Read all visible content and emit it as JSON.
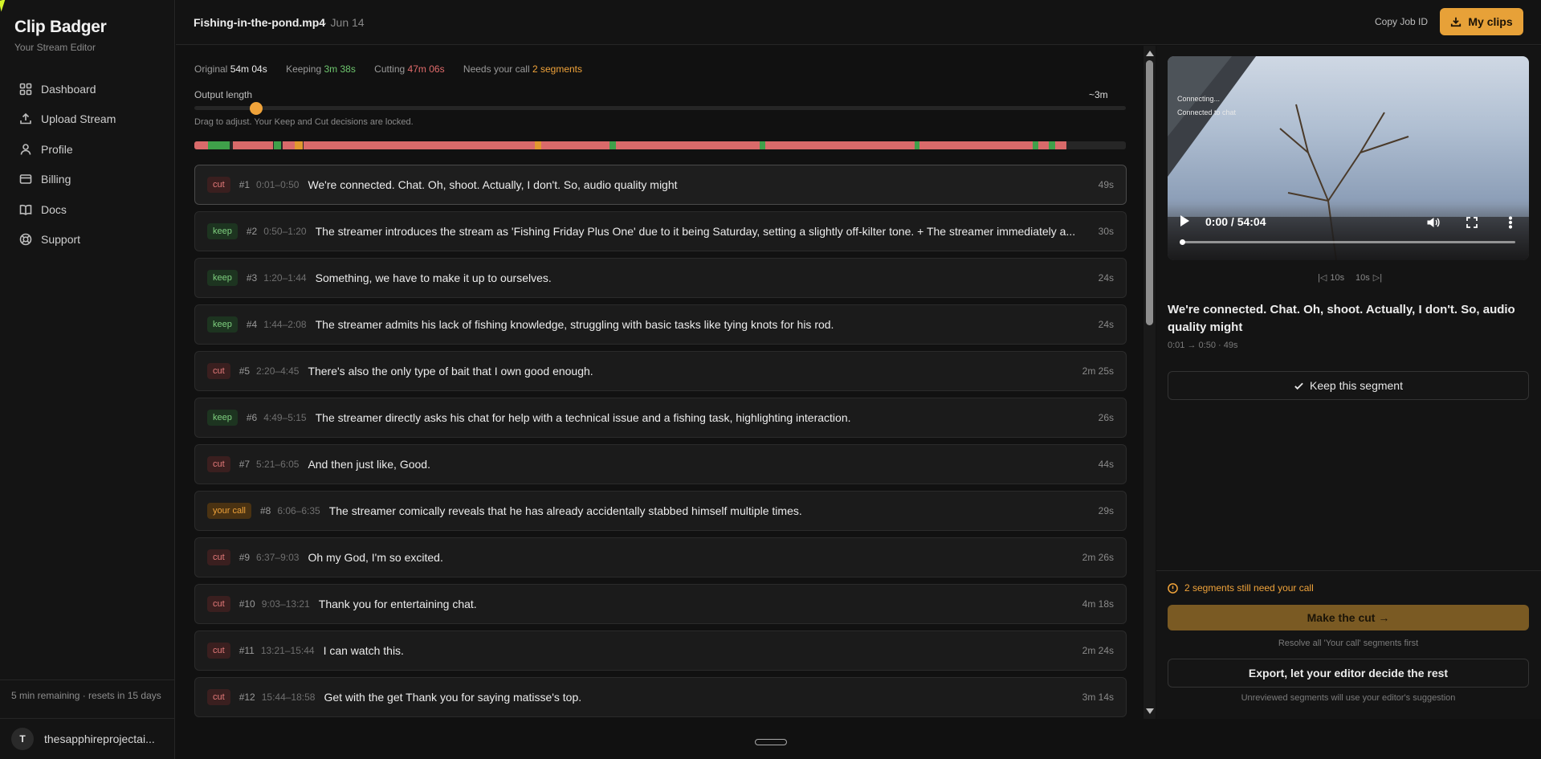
{
  "brand": {
    "title": "Clip Badger",
    "subtitle": "Your Stream Editor"
  },
  "sidebar": {
    "items": [
      {
        "label": "Dashboard",
        "icon": "grid-icon"
      },
      {
        "label": "Upload Stream",
        "icon": "upload-icon"
      },
      {
        "label": "Profile",
        "icon": "user-icon"
      },
      {
        "label": "Billing",
        "icon": "card-icon"
      },
      {
        "label": "Docs",
        "icon": "book-icon"
      },
      {
        "label": "Support",
        "icon": "lifebuoy-icon"
      }
    ],
    "quota": "5 min remaining · resets in 15 days",
    "user": {
      "initial": "T",
      "name": "thesapphireprojectai..."
    }
  },
  "header": {
    "file_name": "Fishing-in-the-pond.mp4",
    "file_date": "· Jun 14",
    "copy_job_id": "Copy Job ID",
    "my_clips": "My clips"
  },
  "stats": {
    "original_label": "Original",
    "original_value": "54m 04s",
    "keeping_label": "Keeping",
    "keeping_value": "3m 38s",
    "cutting_label": "Cutting",
    "cutting_value": "47m 06s",
    "call_label": "Needs your call",
    "call_value": "2 segments"
  },
  "output": {
    "label": "Output length",
    "value": "~3m",
    "slider_fraction": 0.066,
    "hint": "Drag to adjust. Your Keep and Cut decisions are locked."
  },
  "colors": {
    "cut": "#d96a6a",
    "keep": "#3fa04a",
    "call": "#e0982f",
    "accent": "#e7a138"
  },
  "timeline": {
    "total_seconds": 3244,
    "segments": [
      {
        "type": "cut",
        "start": 1,
        "end": 50
      },
      {
        "type": "keep",
        "start": 50,
        "end": 80
      },
      {
        "type": "keep",
        "start": 80,
        "end": 104
      },
      {
        "type": "keep",
        "start": 104,
        "end": 128
      },
      {
        "type": "cut",
        "start": 140,
        "end": 285
      },
      {
        "type": "keep",
        "start": 289,
        "end": 315
      },
      {
        "type": "cut",
        "start": 321,
        "end": 365
      },
      {
        "type": "call",
        "start": 366,
        "end": 395
      },
      {
        "type": "cut",
        "start": 397,
        "end": 543
      },
      {
        "type": "cut",
        "start": 543,
        "end": 801
      },
      {
        "type": "cut",
        "start": 801,
        "end": 944
      },
      {
        "type": "cut",
        "start": 944,
        "end": 1138
      },
      {
        "type": "cut",
        "start": 1138,
        "end": 1240
      },
      {
        "type": "call",
        "start": 1240,
        "end": 1262
      },
      {
        "type": "cut",
        "start": 1262,
        "end": 1512
      },
      {
        "type": "keep",
        "start": 1512,
        "end": 1535
      },
      {
        "type": "cut",
        "start": 1535,
        "end": 2058
      },
      {
        "type": "keep",
        "start": 2058,
        "end": 2078
      },
      {
        "type": "cut",
        "start": 2078,
        "end": 2620
      },
      {
        "type": "keep",
        "start": 2620,
        "end": 2640
      },
      {
        "type": "cut",
        "start": 2640,
        "end": 3050
      },
      {
        "type": "keep",
        "start": 3050,
        "end": 3072
      },
      {
        "type": "cut",
        "start": 3072,
        "end": 3110
      },
      {
        "type": "keep",
        "start": 3110,
        "end": 3132
      },
      {
        "type": "cut",
        "start": 3132,
        "end": 3175
      }
    ]
  },
  "segments": [
    {
      "badge": "cut",
      "num": "#1",
      "time": "0:01–0:50",
      "text": "We're connected. Chat. Oh, shoot. Actually, I don't. So, audio quality might",
      "dur": "49s"
    },
    {
      "badge": "keep",
      "num": "#2",
      "time": "0:50–1:20",
      "text": "The streamer introduces the stream as 'Fishing Friday Plus One' due to it being Saturday, setting a slightly off-kilter tone. + The streamer immediately a...",
      "dur": "30s"
    },
    {
      "badge": "keep",
      "num": "#3",
      "time": "1:20–1:44",
      "text": "Something, we have to make it up to ourselves.",
      "dur": "24s"
    },
    {
      "badge": "keep",
      "num": "#4",
      "time": "1:44–2:08",
      "text": "The streamer admits his lack of fishing knowledge, struggling with basic tasks like tying knots for his rod.",
      "dur": "24s"
    },
    {
      "badge": "cut",
      "num": "#5",
      "time": "2:20–4:45",
      "text": "There's also the only type of bait that I own good enough.",
      "dur": "2m 25s"
    },
    {
      "badge": "keep",
      "num": "#6",
      "time": "4:49–5:15",
      "text": "The streamer directly asks his chat for help with a technical issue and a fishing task, highlighting interaction.",
      "dur": "26s"
    },
    {
      "badge": "cut",
      "num": "#7",
      "time": "5:21–6:05",
      "text": "And then just like, Good.",
      "dur": "44s"
    },
    {
      "badge": "your call",
      "num": "#8",
      "time": "6:06–6:35",
      "text": "The streamer comically reveals that he has already accidentally stabbed himself multiple times.",
      "dur": "29s"
    },
    {
      "badge": "cut",
      "num": "#9",
      "time": "6:37–9:03",
      "text": "Oh my God, I'm so excited.",
      "dur": "2m 26s"
    },
    {
      "badge": "cut",
      "num": "#10",
      "time": "9:03–13:21",
      "text": "Thank you for entertaining chat.",
      "dur": "4m 18s"
    },
    {
      "badge": "cut",
      "num": "#11",
      "time": "13:21–15:44",
      "text": "I can watch this.",
      "dur": "2m 24s"
    },
    {
      "badge": "cut",
      "num": "#12",
      "time": "15:44–18:58",
      "text": "Get with the get Thank you for saying matisse's top.",
      "dur": "3m 14s"
    }
  ],
  "player": {
    "overlay_line1": "Connecting...",
    "overlay_line2": "Connected to chat",
    "time": "0:00 / 54:04",
    "progress_fraction": 0.0,
    "skip_back": "10s",
    "skip_forward": "10s"
  },
  "detail": {
    "title": "We're connected. Chat. Oh, shoot. Actually, I don't. So, audio quality might",
    "meta": "0:01 → 0:50 · 49s",
    "keep_button": "Keep this segment"
  },
  "footer": {
    "warning": "2 segments still need your call",
    "make_cut": "Make the cut →",
    "make_cut_hint": "Resolve all 'Your call' segments first",
    "export": "Export, let your editor decide the rest",
    "export_hint": "Unreviewed segments will use your editor's suggestion"
  }
}
